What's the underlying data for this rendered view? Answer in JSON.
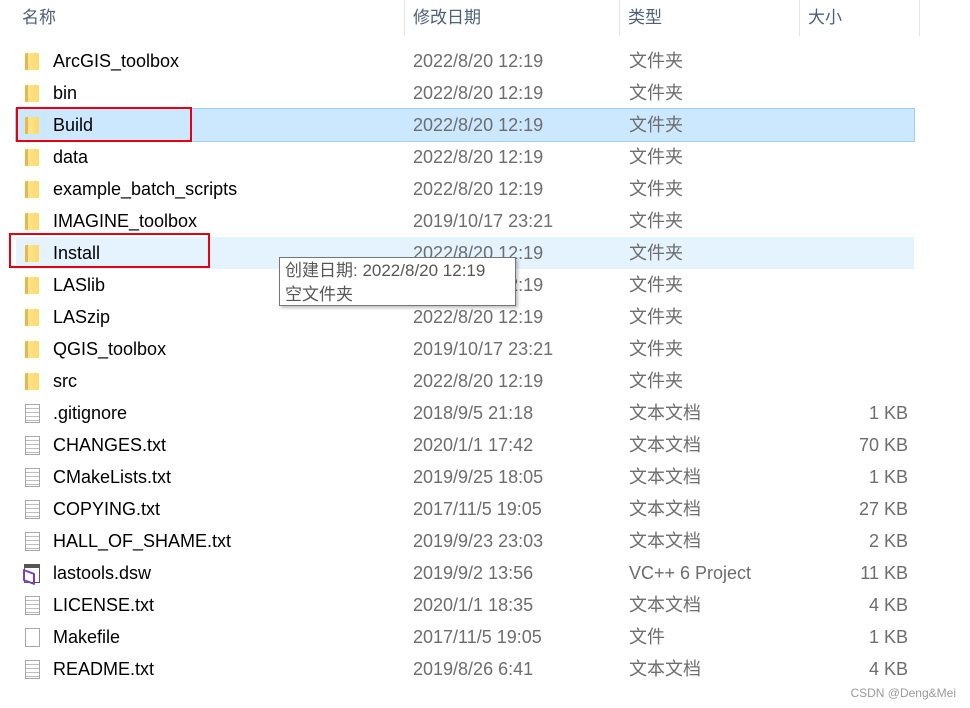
{
  "columns": {
    "name": "名称",
    "date": "修改日期",
    "type": "类型",
    "size": "大小"
  },
  "sort_indicator": "^",
  "rows": [
    {
      "name": "ArcGIS_toolbox",
      "date": "2022/8/20 12:19",
      "type": "文件夹",
      "size": "",
      "icon": "folder-icon"
    },
    {
      "name": "bin",
      "date": "2022/8/20 12:19",
      "type": "文件夹",
      "size": "",
      "icon": "folder-icon"
    },
    {
      "name": "Build",
      "date": "2022/8/20 12:19",
      "type": "文件夹",
      "size": "",
      "icon": "folder-icon",
      "state": "selected"
    },
    {
      "name": "data",
      "date": "2022/8/20 12:19",
      "type": "文件夹",
      "size": "",
      "icon": "folder-icon"
    },
    {
      "name": "example_batch_scripts",
      "date": "2022/8/20 12:19",
      "type": "文件夹",
      "size": "",
      "icon": "folder-icon"
    },
    {
      "name": "IMAGINE_toolbox",
      "date": "2019/10/17 23:21",
      "type": "文件夹",
      "size": "",
      "icon": "folder-icon"
    },
    {
      "name": "Install",
      "date": "2022/8/20 12:19",
      "type": "文件夹",
      "size": "",
      "icon": "folder-icon",
      "state": "hover"
    },
    {
      "name": "LASlib",
      "date": "2022/8/20 12:19",
      "type": "文件夹",
      "size": "",
      "icon": "folder-icon"
    },
    {
      "name": "LASzip",
      "date": "2022/8/20 12:19",
      "type": "文件夹",
      "size": "",
      "icon": "folder-icon"
    },
    {
      "name": "QGIS_toolbox",
      "date": "2019/10/17 23:21",
      "type": "文件夹",
      "size": "",
      "icon": "folder-icon"
    },
    {
      "name": "src",
      "date": "2022/8/20 12:19",
      "type": "文件夹",
      "size": "",
      "icon": "folder-icon"
    },
    {
      "name": ".gitignore",
      "date": "2018/9/5 21:18",
      "type": "文本文档",
      "size": "1 KB",
      "icon": "text-file-icon"
    },
    {
      "name": "CHANGES.txt",
      "date": "2020/1/1 17:42",
      "type": "文本文档",
      "size": "70 KB",
      "icon": "text-file-icon"
    },
    {
      "name": "CMakeLists.txt",
      "date": "2019/9/25 18:05",
      "type": "文本文档",
      "size": "1 KB",
      "icon": "text-file-icon"
    },
    {
      "name": "COPYING.txt",
      "date": "2017/11/5 19:05",
      "type": "文本文档",
      "size": "27 KB",
      "icon": "text-file-icon"
    },
    {
      "name": "HALL_OF_SHAME.txt",
      "date": "2019/9/23 23:03",
      "type": "文本文档",
      "size": "2 KB",
      "icon": "text-file-icon"
    },
    {
      "name": "lastools.dsw",
      "date": "2019/9/2 13:56",
      "type": "VC++ 6 Project",
      "size": "11 KB",
      "icon": "visual-studio-icon"
    },
    {
      "name": "LICENSE.txt",
      "date": "2020/1/1 18:35",
      "type": "文本文档",
      "size": "4 KB",
      "icon": "text-file-icon"
    },
    {
      "name": "Makefile",
      "date": "2017/11/5 19:05",
      "type": "文件",
      "size": "1 KB",
      "icon": "blank-file-icon"
    },
    {
      "name": "README.txt",
      "date": "2019/8/26 6:41",
      "type": "文本文档",
      "size": "4 KB",
      "icon": "text-file-icon"
    }
  ],
  "tooltip": {
    "line1": "创建日期: 2022/8/20 12:19",
    "line2": "空文件夹"
  },
  "watermark": "CSDN @Deng&Mei",
  "colors": {
    "selected": "#cce8ff",
    "hover": "#e5f3ff",
    "annotation": "#e50012"
  }
}
